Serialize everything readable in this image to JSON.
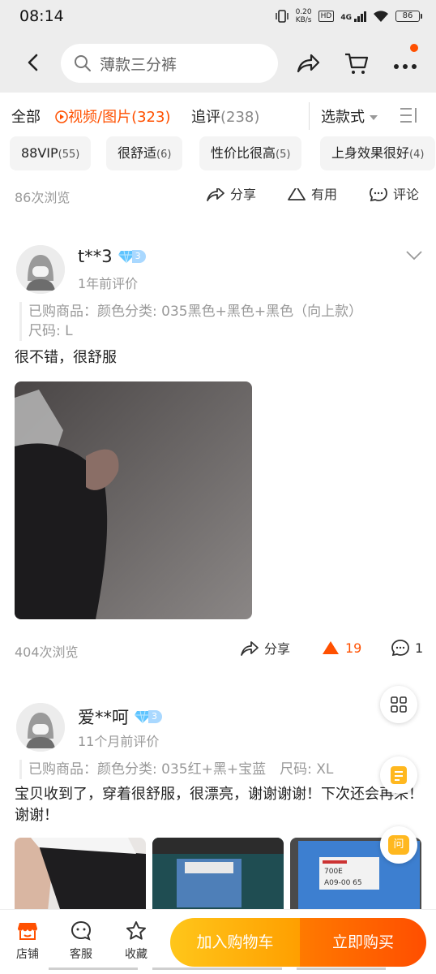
{
  "status_bar": {
    "time": "08:14",
    "net_speed_value": "0.20",
    "net_speed_unit": "KB/s",
    "hd_label": "HD",
    "signal_label": "4G",
    "battery": "86"
  },
  "header": {
    "search_text": "薄款三分裤"
  },
  "tabs": {
    "all": "全部",
    "media_label": "视频/图片",
    "media_count": "(323)",
    "followup_label": "追评",
    "followup_count": "(238)",
    "select_style": "选款式"
  },
  "chips": [
    {
      "label": "88VIP",
      "count": "(55)"
    },
    {
      "label": "很舒适",
      "count": "(6)"
    },
    {
      "label": "性价比很高",
      "count": "(5)"
    },
    {
      "label": "上身效果很好",
      "count": "(4)"
    }
  ],
  "stats_top": {
    "views": "86次浏览",
    "share": "分享",
    "useful": "有用",
    "comment": "评论"
  },
  "reviews": [
    {
      "user": "t**3",
      "vip_level": "3",
      "time": "1年前评价",
      "spec_line1": "已购商品：颜色分类: 035黑色+黑色+黑色（向上款）",
      "spec_line2": "尺码: L",
      "text": "很不错，很舒服",
      "views": "404次浏览",
      "share": "分享",
      "likes": "19",
      "comments": "1"
    },
    {
      "user": "爱**呵",
      "vip_level": "3",
      "time": "11个月前评价",
      "spec_line1": "已购商品：颜色分类: 035红+黑+宝蓝　尺码: XL",
      "text": "宝贝收到了，穿着很舒服，很漂亮，谢谢谢谢！下次还会再来！谢谢！",
      "photo_labels": [
        "700E",
        "A09-00 65"
      ]
    }
  ],
  "floating": {
    "ask_label": "问"
  },
  "bottom_bar": {
    "shop": "店铺",
    "service": "客服",
    "favorite": "收藏",
    "add_cart": "加入购物车",
    "buy_now": "立即购买"
  },
  "colors": {
    "accent": "#ff5000",
    "cart_button": "#ffb300",
    "buy_button": "#ff5000"
  }
}
